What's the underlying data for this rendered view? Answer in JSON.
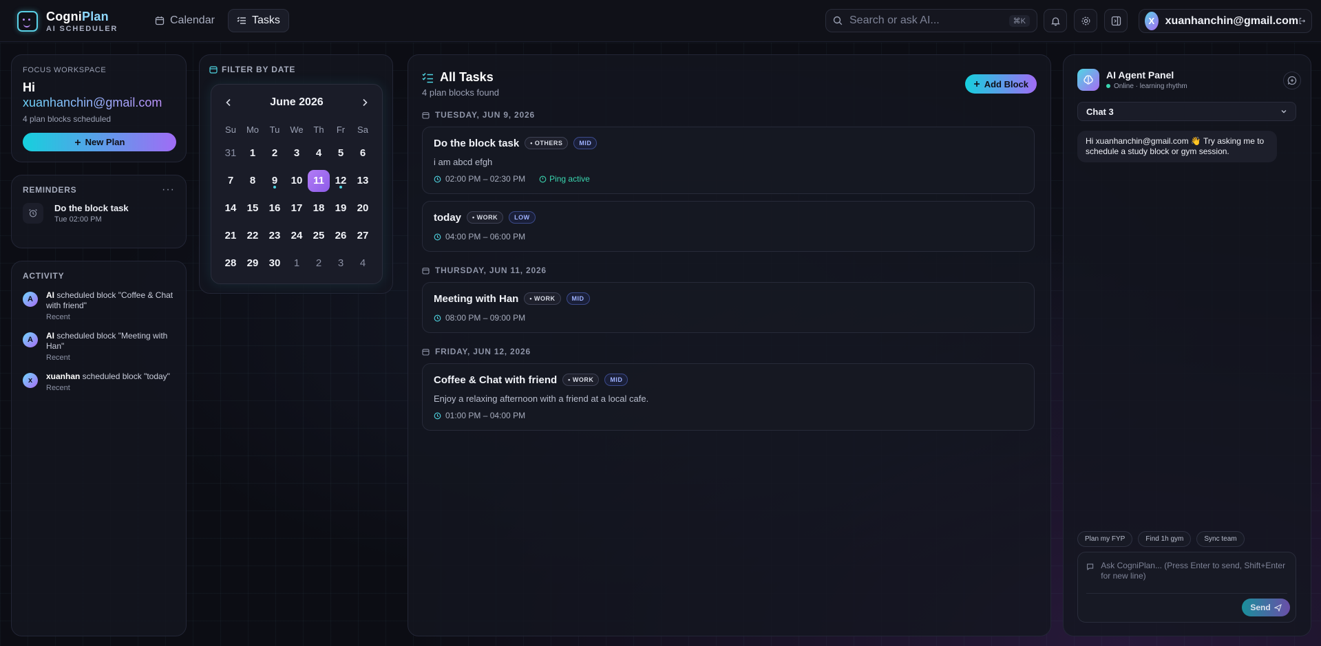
{
  "app": {
    "name_part1": "Cogni",
    "name_part2": "Plan",
    "subtitle": "AI SCHEDULER"
  },
  "nav": {
    "calendar": "Calendar",
    "tasks": "Tasks"
  },
  "search": {
    "placeholder": "Search or ask AI...",
    "shortcut": "⌘K"
  },
  "user": {
    "initial": "X",
    "email": "xuanhanchin@gmail.com"
  },
  "welcome": {
    "eyebrow": "FOCUS WORKSPACE",
    "greeting": "Hi",
    "email": "xuanhanchin@gmail.com",
    "summary": "4 plan blocks scheduled",
    "new_plan_label": "New Plan"
  },
  "reminders": {
    "title": "REMINDERS",
    "items": [
      {
        "title": "Do the block task",
        "time": "Tue 02:00 PM"
      }
    ]
  },
  "activity": {
    "title": "ACTIVITY",
    "items": [
      {
        "avatar": "A",
        "actor": "AI",
        "text": " scheduled block \"Coffee & Chat with friend\"",
        "time": "Recent"
      },
      {
        "avatar": "A",
        "actor": "AI",
        "text": " scheduled block \"Meeting with Han\"",
        "time": "Recent"
      },
      {
        "avatar": "x",
        "actor": "xuanhan",
        "text": " scheduled block \"today\"",
        "time": "Recent"
      }
    ]
  },
  "calendar": {
    "filter_title": "FILTER BY DATE",
    "month_label": "June 2026",
    "weekdays": [
      "Su",
      "Mo",
      "Tu",
      "We",
      "Th",
      "Fr",
      "Sa"
    ],
    "selected_day": "11",
    "days": [
      {
        "d": "31",
        "muted": true
      },
      {
        "d": "1"
      },
      {
        "d": "2"
      },
      {
        "d": "3"
      },
      {
        "d": "4"
      },
      {
        "d": "5"
      },
      {
        "d": "6"
      },
      {
        "d": "7"
      },
      {
        "d": "8"
      },
      {
        "d": "9",
        "dot": true
      },
      {
        "d": "10"
      },
      {
        "d": "11",
        "selected": true
      },
      {
        "d": "12",
        "dot": true
      },
      {
        "d": "13"
      },
      {
        "d": "14"
      },
      {
        "d": "15"
      },
      {
        "d": "16"
      },
      {
        "d": "17"
      },
      {
        "d": "18"
      },
      {
        "d": "19"
      },
      {
        "d": "20"
      },
      {
        "d": "21"
      },
      {
        "d": "22"
      },
      {
        "d": "23"
      },
      {
        "d": "24"
      },
      {
        "d": "25"
      },
      {
        "d": "26"
      },
      {
        "d": "27"
      },
      {
        "d": "28"
      },
      {
        "d": "29"
      },
      {
        "d": "30"
      },
      {
        "d": "1",
        "muted": true
      },
      {
        "d": "2",
        "muted": true
      },
      {
        "d": "3",
        "muted": true
      },
      {
        "d": "4",
        "muted": true
      }
    ]
  },
  "tasks": {
    "title": "All Tasks",
    "count": "4 plan blocks found",
    "add_label": "Add Block",
    "groups": [
      {
        "date": "TUESDAY, JUN 9, 2026",
        "items": [
          {
            "name": "Do the block task",
            "category": "OTHERS",
            "priority": "MID",
            "desc": "i am abcd efgh",
            "time": "02:00 PM – 02:30 PM",
            "ping": "Ping active"
          },
          {
            "name": "today",
            "category": "WORK",
            "priority": "LOW",
            "desc": "",
            "time": "04:00 PM – 06:00 PM",
            "ping": ""
          }
        ]
      },
      {
        "date": "THURSDAY, JUN 11, 2026",
        "items": [
          {
            "name": "Meeting with Han",
            "category": "WORK",
            "priority": "MID",
            "desc": "",
            "time": "08:00 PM – 09:00 PM",
            "ping": ""
          }
        ]
      },
      {
        "date": "FRIDAY, JUN 12, 2026",
        "items": [
          {
            "name": "Coffee & Chat with friend",
            "category": "WORK",
            "priority": "MID",
            "desc": "Enjoy a relaxing afternoon with a friend at a local cafe.",
            "time": "01:00 PM – 04:00 PM",
            "ping": ""
          }
        ]
      }
    ]
  },
  "agent": {
    "title": "AI Agent Panel",
    "status": "Online · learning rhythm",
    "chat_selected": "Chat 3",
    "message": "Hi xuanhanchin@gmail.com  👋 Try asking me to schedule a study block or gym session.",
    "chips": [
      "Plan my FYP",
      "Find 1h gym",
      "Sync team"
    ],
    "composer_placeholder": "Ask CogniPlan... (Press Enter to send, Shift+Enter for new line)",
    "send_label": "Send"
  },
  "colors": {
    "accent_cyan": "#16d0dd",
    "accent_purple": "#a06cf5",
    "background": "#0c0d14",
    "ping_green": "#3ad6b0"
  }
}
